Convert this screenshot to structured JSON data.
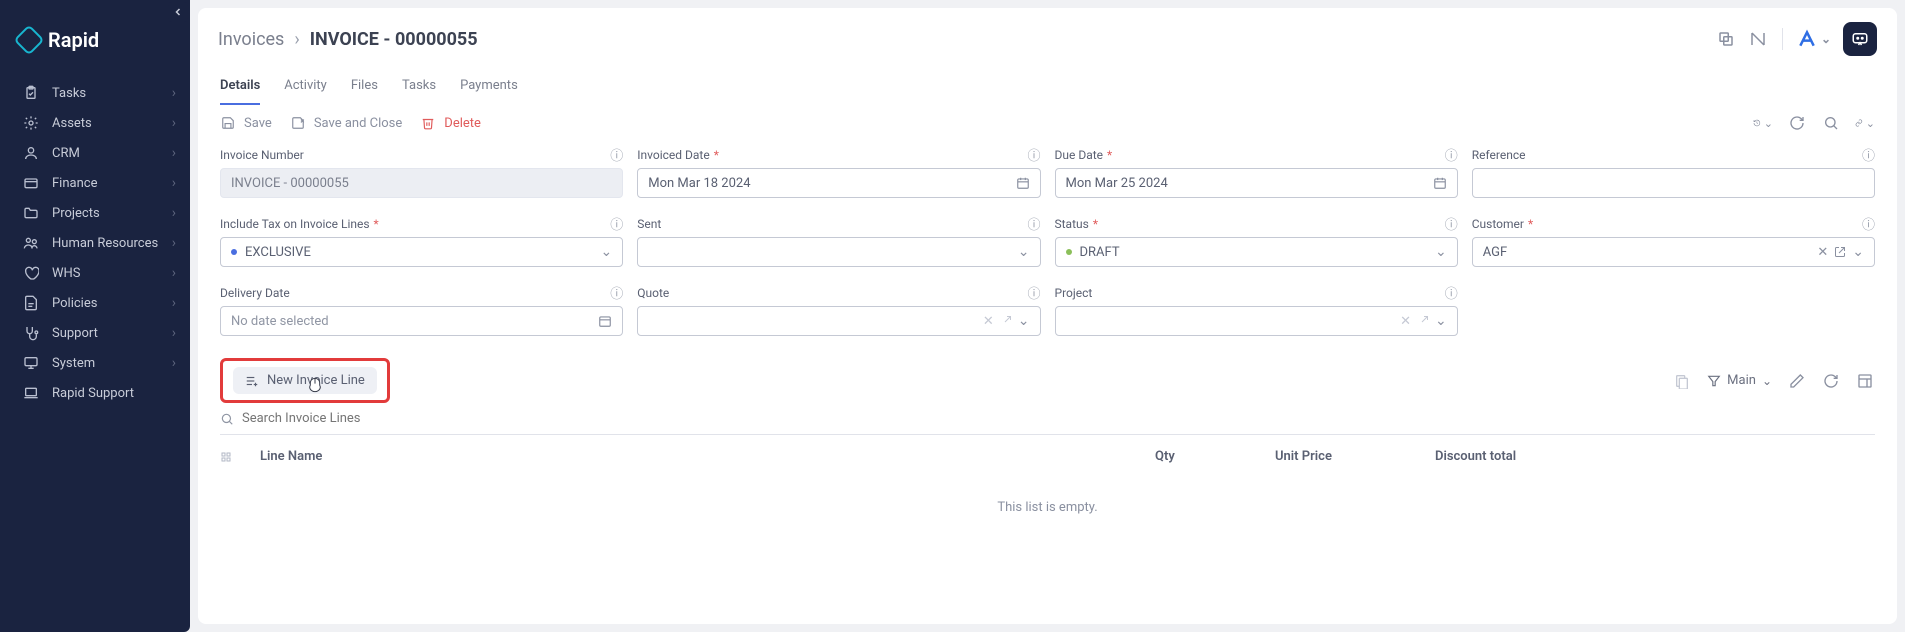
{
  "brand": "Rapid",
  "sidebar": {
    "items": [
      {
        "label": "Tasks",
        "icon": "clipboard",
        "expandable": true
      },
      {
        "label": "Assets",
        "icon": "gear",
        "expandable": true
      },
      {
        "label": "CRM",
        "icon": "user",
        "expandable": true
      },
      {
        "label": "Finance",
        "icon": "wallet",
        "expandable": true
      },
      {
        "label": "Projects",
        "icon": "folder",
        "expandable": true
      },
      {
        "label": "Human Resources",
        "icon": "people",
        "expandable": true
      },
      {
        "label": "WHS",
        "icon": "heart",
        "expandable": true
      },
      {
        "label": "Policies",
        "icon": "doc",
        "expandable": true
      },
      {
        "label": "Support",
        "icon": "stetho",
        "expandable": true
      },
      {
        "label": "System",
        "icon": "monitor",
        "expandable": true
      },
      {
        "label": "Rapid Support",
        "icon": "laptop",
        "expandable": false
      }
    ]
  },
  "breadcrumb": {
    "parent": "Invoices",
    "current": "INVOICE - 00000055"
  },
  "tabs": [
    {
      "label": "Details",
      "active": true
    },
    {
      "label": "Activity",
      "active": false
    },
    {
      "label": "Files",
      "active": false
    },
    {
      "label": "Tasks",
      "active": false
    },
    {
      "label": "Payments",
      "active": false
    }
  ],
  "actions": {
    "save": "Save",
    "saveClose": "Save and Close",
    "delete": "Delete"
  },
  "fields": {
    "invoiceNumber": {
      "label": "Invoice Number",
      "value": "INVOICE - 00000055",
      "required": false
    },
    "invoicedDate": {
      "label": "Invoiced Date",
      "value": "Mon Mar 18 2024",
      "required": true
    },
    "dueDate": {
      "label": "Due Date",
      "value": "Mon Mar 25 2024",
      "required": true
    },
    "reference": {
      "label": "Reference",
      "value": "",
      "required": false
    },
    "includeTax": {
      "label": "Include Tax on Invoice Lines",
      "value": "EXCLUSIVE",
      "required": true
    },
    "sent": {
      "label": "Sent",
      "value": "",
      "required": false
    },
    "status": {
      "label": "Status",
      "value": "DRAFT",
      "required": true
    },
    "customer": {
      "label": "Customer",
      "value": "AGF",
      "required": true
    },
    "deliveryDate": {
      "label": "Delivery Date",
      "value": "No date selected",
      "required": false
    },
    "quote": {
      "label": "Quote",
      "value": "",
      "required": false
    },
    "project": {
      "label": "Project",
      "value": "",
      "required": false
    }
  },
  "lines": {
    "newBtn": "New Invoice Line",
    "searchPlaceholder": "Search Invoice Lines",
    "filterLabel": "Main",
    "columns": {
      "name": "Line Name",
      "qty": "Qty",
      "unitPrice": "Unit Price",
      "discount": "Discount total"
    },
    "emptyMsg": "This list is empty."
  }
}
